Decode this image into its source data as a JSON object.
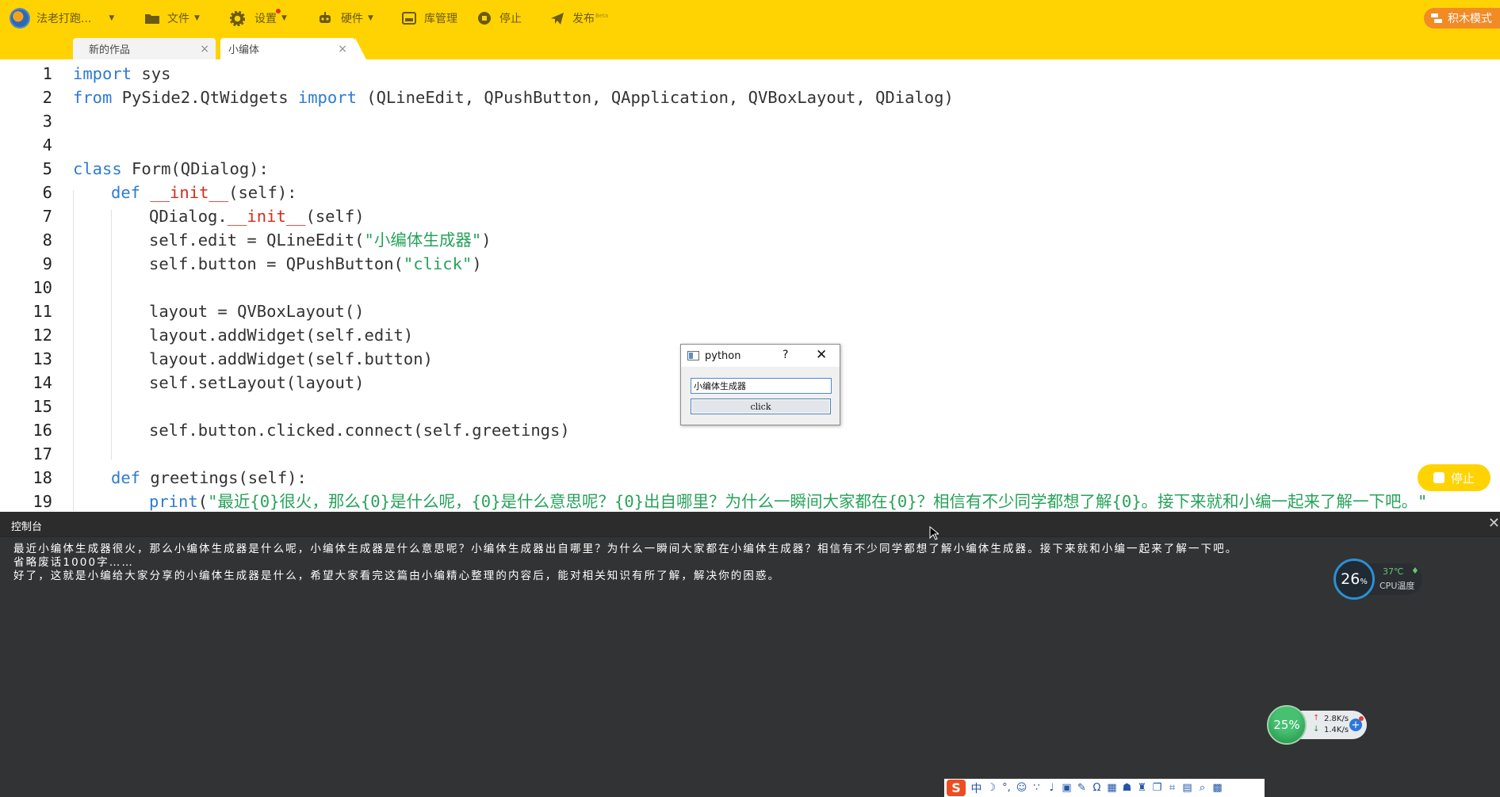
{
  "toolbar": {
    "user_label": "法老打跑...",
    "file_label": "文件",
    "settings_label": "设置",
    "hardware_label": "硬件",
    "library_label": "库管理",
    "stop_label": "停止",
    "publish_label": "发布",
    "publish_badge": "Beta",
    "block_mode_label": "积木模式"
  },
  "tabs": [
    {
      "label": "新的作品",
      "close": "×",
      "active": false
    },
    {
      "label": "小编体",
      "close": "×",
      "active": true
    }
  ],
  "editor": {
    "line_numbers": [
      "1",
      "2",
      "3",
      "4",
      "5",
      "6",
      "7",
      "8",
      "9",
      "10",
      "11",
      "12",
      "13",
      "14",
      "15",
      "16",
      "17",
      "18",
      "19"
    ],
    "tokens": {
      "l1_kw": "import",
      "l1_rest": " sys",
      "l2_kw1": "from",
      "l2_mid": " PySide2.QtWidgets ",
      "l2_kw2": "import",
      "l2_rest": " (QLineEdit, QPushButton, QApplication, QVBoxLayout, QDialog)",
      "l5_kw": "class",
      "l5_rest": " Form(QDialog):",
      "l6_kw": "def",
      "l6_sp": " ",
      "l6_dn": "__init__",
      "l6_rest": "(self):",
      "l7_a": "QDialog.",
      "l7_dn": "__init__",
      "l7_rest": "(self)",
      "l8_a": "self.edit = QLineEdit(",
      "l8_str": "\"小编体生成器\"",
      "l8_rest": ")",
      "l9_a": "self.button = QPushButton(",
      "l9_str": "\"click\"",
      "l9_rest": ")",
      "l11": "layout = QVBoxLayout()",
      "l12": "layout.addWidget(self.edit)",
      "l13": "layout.addWidget(self.button)",
      "l14": "self.setLayout(layout)",
      "l16": "self.button.clicked.connect(self.greetings)",
      "l18_kw": "def",
      "l18_rest": " greetings(self):",
      "l19_kw": "print",
      "l19_a": "(",
      "l19_str": "\"最近{0}很火，那么{0}是什么呢，{0}是什么意思呢？{0}出自哪里？为什么一瞬间大家都在{0}？相信有不少同学都想了解{0}。接下来就和小编一起来了解一下吧。\""
    }
  },
  "float_stop_label": "停止",
  "dialog": {
    "title": "python",
    "help": "?",
    "close": "✕",
    "input_value": "小编体生成器",
    "button_label": "click"
  },
  "console": {
    "title": "控制台",
    "close": "✕",
    "lines": [
      "最近小编体生成器很火，那么小编体生成器是什么呢，小编体生成器是什么意思呢？小编体生成器出自哪里？为什么一瞬间大家都在小编体生成器？相信有不少同学都想了解小编体生成器。接下来就和小编一起来了解一下吧。",
      "省略废话1000字……",
      "好了，这就是小编给大家分享的小编体生成器是什么，希望大家看完这篇由小编精心整理的内容后，能对相关知识有所了解，解决你的困惑。"
    ]
  },
  "cpu_monitor": {
    "usage": "26",
    "usage_unit": "%",
    "temp": "37℃",
    "label": "CPU温度"
  },
  "net_monitor": {
    "usage": "25%",
    "up": "2.8K/s",
    "down": "1.4K/s"
  },
  "ime": {
    "logo": "S",
    "mode": "中"
  },
  "colors": {
    "toolbar": "#ffd302",
    "keyword": "#2e7bd1",
    "string": "#27a25a",
    "dunder": "#d32f1e",
    "console_bg": "#323334"
  }
}
